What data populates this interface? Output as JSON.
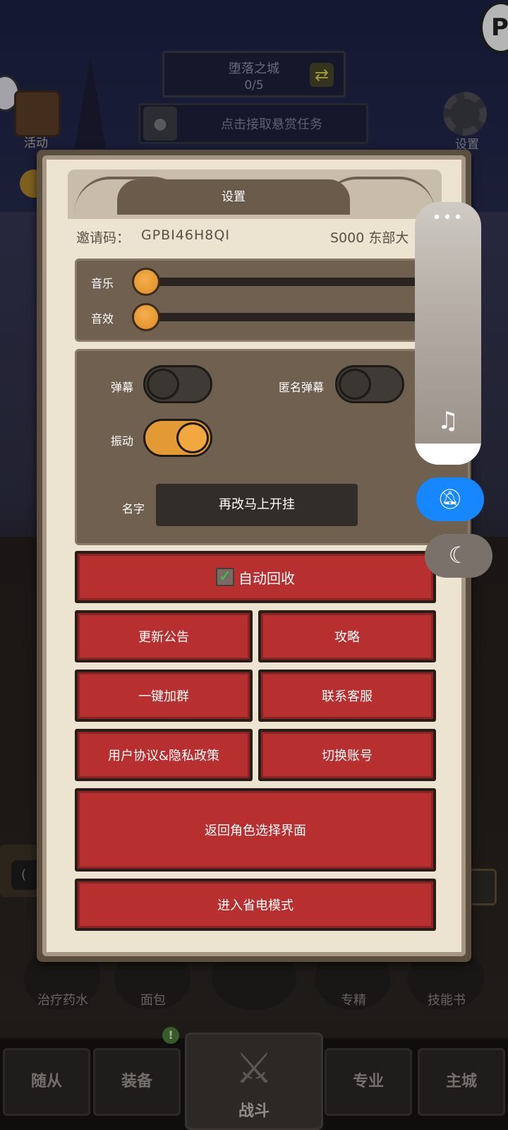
{
  "background": {
    "region": {
      "name": "堕落之城",
      "progress": "0/5"
    },
    "bounty_task": "点击接取悬赏任务",
    "activity_label": "活动",
    "settings_label": "设置",
    "items": [
      {
        "label": "治疗药水"
      },
      {
        "label": "面包"
      },
      {
        "label": ""
      },
      {
        "label": "专精"
      },
      {
        "label": "技能书"
      }
    ],
    "nav": {
      "followers": "随从",
      "equipment": "装备",
      "equipment_badge": "!",
      "battle": "战斗",
      "profession": "专业",
      "main_city": "主城"
    }
  },
  "dialog": {
    "title": "设置",
    "invite_label": "邀请码：",
    "invite_code": "GPBI46H8QI",
    "server": "S000 东部大",
    "sliders": {
      "music": {
        "label": "音乐",
        "value": 0
      },
      "sound": {
        "label": "音效",
        "value": 0
      }
    },
    "toggles": {
      "danmaku": {
        "label": "弹幕",
        "on": false
      },
      "anon_danmaku": {
        "label": "匿名弹幕",
        "on": false
      },
      "vibration": {
        "label": "振动",
        "on": true
      }
    },
    "name": {
      "label": "名字",
      "value": "再改马上开挂"
    },
    "buttons": {
      "auto_recycle": "自动回收",
      "update_notice": "更新公告",
      "guide": "攻略",
      "join_group": "一键加群",
      "contact_service": "联系客服",
      "agreement": "用户协议&隐私政策",
      "switch_account": "切换账号",
      "back_to_role": "返回角色选择界面",
      "power_saving": "进入省电模式"
    }
  },
  "overlay": {
    "more_icon": "more-icon",
    "music_icon": "music-icon",
    "mute_bell_icon": "bell-off-icon",
    "moon_icon": "moon-icon"
  }
}
